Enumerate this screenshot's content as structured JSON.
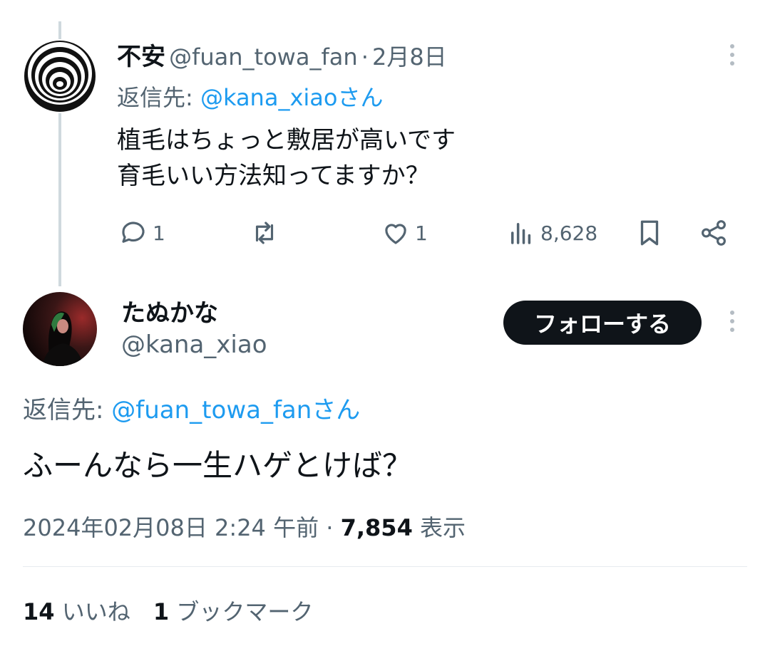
{
  "reply_tweet": {
    "author_name": "不安",
    "handle": "@fuan_towa_fan",
    "separator": "·",
    "date": "2月8日",
    "reply_to_label": "返信先:",
    "reply_to_handle": "@kana_xiaoさん",
    "text_line1": "植毛はちょっと敷居が高いです",
    "text_line2": "育毛いい方法知ってますか？",
    "actions": {
      "replies": "1",
      "retweets": "",
      "likes": "1",
      "views": "8,628"
    }
  },
  "main_tweet": {
    "author_name": "たぬかな",
    "handle": "@kana_xiao",
    "follow_label": "フォローする",
    "reply_to_label": "返信先:",
    "reply_to_handle": "@fuan_towa_fanさん",
    "text": "ふーんなら一生ハゲとけば？",
    "timestamp": "2024年02月08日 2:24 午前",
    "separator": "·",
    "view_count": "7,854",
    "view_label": "表示",
    "likes_count": "14",
    "likes_label": "いいね",
    "bookmarks_count": "1",
    "bookmarks_label": "ブックマーク"
  },
  "colors": {
    "text": "#0f1419",
    "muted": "#536471",
    "link": "#1d9bf0",
    "thread_line": "#cfd9de"
  },
  "icons": [
    "spiral-avatar",
    "reply-icon",
    "retweet-icon",
    "like-icon",
    "views-icon",
    "bookmark-icon",
    "share-icon",
    "more-icon"
  ]
}
